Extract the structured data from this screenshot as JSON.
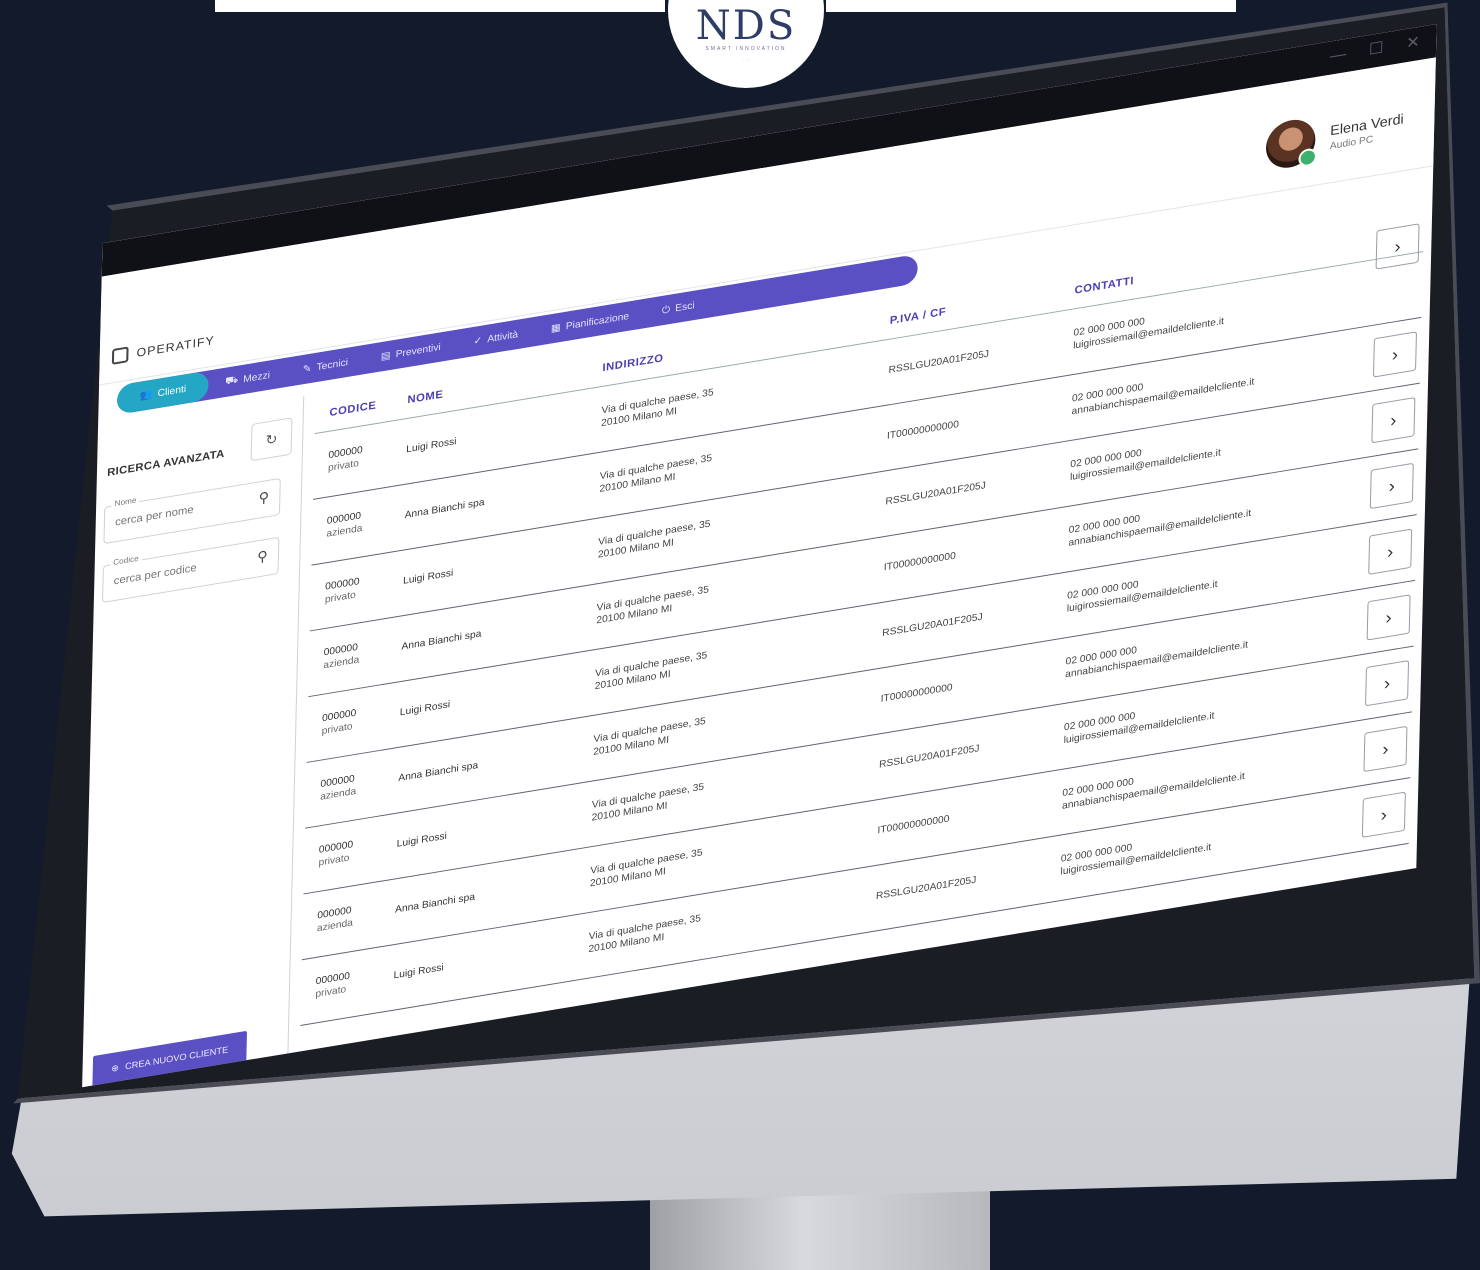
{
  "brand_logo": {
    "mark": "NDS",
    "tagline": "SMART INNOVATION"
  },
  "window": {
    "minimize": "—",
    "maximize": "☐",
    "close": "✕"
  },
  "app": {
    "name": "OPERATIFY"
  },
  "user": {
    "name": "Elena Verdi",
    "role": "Audio PC"
  },
  "tabs": [
    {
      "icon": "users",
      "label": "Clienti"
    },
    {
      "icon": "truck",
      "label": "Mezzi"
    },
    {
      "icon": "wrench",
      "label": "Tecnici"
    },
    {
      "icon": "file",
      "label": "Preventivi"
    },
    {
      "icon": "check",
      "label": "Attività"
    },
    {
      "icon": "calendar",
      "label": "Pianificazione"
    },
    {
      "icon": "power",
      "label": "Esci"
    }
  ],
  "sidebar": {
    "title": "RICERCA AVANZATA",
    "reset_icon": "↻",
    "name_field": {
      "label": "Nome",
      "placeholder": "cerca per nome"
    },
    "code_field": {
      "label": "Codice",
      "placeholder": "cerca per codice"
    },
    "new_client": "CREA NUOVO CLIENTE"
  },
  "table": {
    "headers": {
      "codice": "CODICE",
      "nome": "NOME",
      "indirizzo": "INDIRIZZO",
      "piva": "P.IVA / CF",
      "contatti": "CONTATTI"
    },
    "rows": [
      {
        "code": "000000",
        "type": "privato",
        "name": "Luigi Rossi",
        "addr1": "Via di qualche paese, 35",
        "addr2": "20100 Milano MI",
        "piva": "RSSLGU20A01F205J",
        "phone": "02 000 000 000",
        "email": "luigirossiemail@emaildelcliente.it"
      },
      {
        "code": "000000",
        "type": "azienda",
        "name": "Anna Bianchi spa",
        "addr1": "Via di qualche paese, 35",
        "addr2": "20100 Milano MI",
        "piva": "IT00000000000",
        "phone": "02 000 000 000",
        "email": "annabianchispaemail@emaildelcliente.it"
      },
      {
        "code": "000000",
        "type": "privato",
        "name": "Luigi Rossi",
        "addr1": "Via di qualche paese, 35",
        "addr2": "20100 Milano MI",
        "piva": "RSSLGU20A01F205J",
        "phone": "02 000 000 000",
        "email": "luigirossiemail@emaildelcliente.it"
      },
      {
        "code": "000000",
        "type": "azienda",
        "name": "Anna Bianchi spa",
        "addr1": "Via di qualche paese, 35",
        "addr2": "20100 Milano MI",
        "piva": "IT00000000000",
        "phone": "02 000 000 000",
        "email": "annabianchispaemail@emaildelcliente.it"
      },
      {
        "code": "000000",
        "type": "privato",
        "name": "Luigi Rossi",
        "addr1": "Via di qualche paese, 35",
        "addr2": "20100 Milano MI",
        "piva": "RSSLGU20A01F205J",
        "phone": "02 000 000 000",
        "email": "luigirossiemail@emaildelcliente.it"
      },
      {
        "code": "000000",
        "type": "azienda",
        "name": "Anna Bianchi spa",
        "addr1": "Via di qualche paese, 35",
        "addr2": "20100 Milano MI",
        "piva": "IT00000000000",
        "phone": "02 000 000 000",
        "email": "annabianchispaemail@emaildelcliente.it"
      },
      {
        "code": "000000",
        "type": "privato",
        "name": "Luigi Rossi",
        "addr1": "Via di qualche paese, 35",
        "addr2": "20100 Milano MI",
        "piva": "RSSLGU20A01F205J",
        "phone": "02 000 000 000",
        "email": "luigirossiemail@emaildelcliente.it"
      },
      {
        "code": "000000",
        "type": "azienda",
        "name": "Anna Bianchi spa",
        "addr1": "Via di qualche paese, 35",
        "addr2": "20100 Milano MI",
        "piva": "IT00000000000",
        "phone": "02 000 000 000",
        "email": "annabianchispaemail@emaildelcliente.it"
      },
      {
        "code": "000000",
        "type": "privato",
        "name": "Luigi Rossi",
        "addr1": "Via di qualche paese, 35",
        "addr2": "20100 Milano MI",
        "piva": "RSSLGU20A01F205J",
        "phone": "02 000 000 000",
        "email": "luigirossiemail@emaildelcliente.it"
      }
    ],
    "row_action": "›"
  },
  "colors": {
    "accent": "#5b4fc4",
    "active_tab": "#24a7c4",
    "background": "#121a2b",
    "header_text": "#4a3fb0"
  }
}
